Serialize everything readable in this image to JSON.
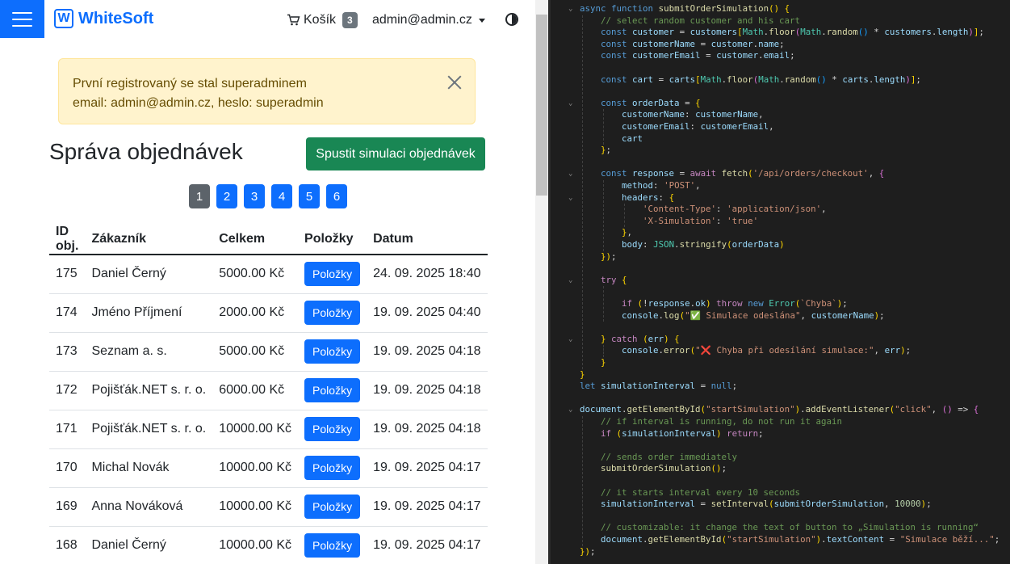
{
  "navbar": {
    "brand_logo": "W",
    "brand": "WhiteSoft",
    "cart_label": "Košík",
    "cart_count": "3",
    "user": "admin@admin.cz"
  },
  "alert": {
    "line1": "První registrovaný se stal superadminem",
    "line2": "email: admin@admin.cz, heslo: superadmin"
  },
  "page": {
    "title": "Správa objednávek",
    "simulate_button": "Spustit simulaci objednávek"
  },
  "pagination": [
    "1",
    "2",
    "3",
    "4",
    "5",
    "6"
  ],
  "table": {
    "headers": [
      "ID obj.",
      "Zákazník",
      "Celkem",
      "Položky",
      "Datum"
    ],
    "items_button": "Položky",
    "rows": [
      {
        "id": "175",
        "customer": "Daniel Černý",
        "total": "5000.00 Kč",
        "date": "24. 09. 2025 18:40"
      },
      {
        "id": "174",
        "customer": "Jméno Příjmení",
        "total": "2000.00 Kč",
        "date": "19. 09. 2025 04:40"
      },
      {
        "id": "173",
        "customer": "Seznam a. s.",
        "total": "5000.00 Kč",
        "date": "19. 09. 2025 04:18"
      },
      {
        "id": "172",
        "customer": "Pojišťák.NET s. r. o.",
        "total": "6000.00 Kč",
        "date": "19. 09. 2025 04:18"
      },
      {
        "id": "171",
        "customer": "Pojišťák.NET s. r. o.",
        "total": "10000.00 Kč",
        "date": "19. 09. 2025 04:18"
      },
      {
        "id": "170",
        "customer": "Michal Novák",
        "total": "10000.00 Kč",
        "date": "19. 09. 2025 04:17"
      },
      {
        "id": "169",
        "customer": "Anna Nováková",
        "total": "10000.00 Kč",
        "date": "19. 09. 2025 04:17"
      },
      {
        "id": "168",
        "customer": "Daniel Černý",
        "total": "10000.00 Kč",
        "date": "19. 09. 2025 04:17"
      }
    ]
  },
  "code": {
    "lines": [
      "async function submitOrderSimulation() {",
      "    // select random customer and his cart",
      "    const customer = customers[Math.floor(Math.random() * customers.length)];",
      "    const customerName = customer.name;",
      "    const customerEmail = customer.email;",
      "",
      "    const cart = carts[Math.floor(Math.random() * carts.length)];",
      "",
      "    const orderData = {",
      "        customerName: customerName,",
      "        customerEmail: customerEmail,",
      "        cart",
      "    };",
      "",
      "    const response = await fetch('/api/orders/checkout', {",
      "        method: 'POST',",
      "        headers: {",
      "            'Content-Type': 'application/json',",
      "            'X-Simulation': 'true'",
      "        },",
      "        body: JSON.stringify(orderData)",
      "    });",
      "",
      "    try {",
      "",
      "        if (!response.ok) throw new Error(`Chyba`);",
      "        console.log(\"✅ Simulace odeslána\", customerName);",
      "",
      "    } catch (err) {",
      "        console.error(\"❌ Chyba při odesílání simulace:\", err);",
      "    }",
      "}",
      "let simulationInterval = null;",
      "",
      "document.getElementById(\"startSimulation\").addEventListener(\"click\", () => {",
      "    // if interval is running, do not run it again",
      "    if (simulationInterval) return;",
      "",
      "    // sends order immediately",
      "    submitOrderSimulation();",
      "",
      "    // it starts interval every 10 seconds",
      "    simulationInterval = setInterval(submitOrderSimulation, 10000);",
      "",
      "    // customizable: it change the text of button to „Simulation is running“",
      "    document.getElementById(\"startSimulation\").textContent = \"Simulace běží...\";",
      "});"
    ]
  }
}
